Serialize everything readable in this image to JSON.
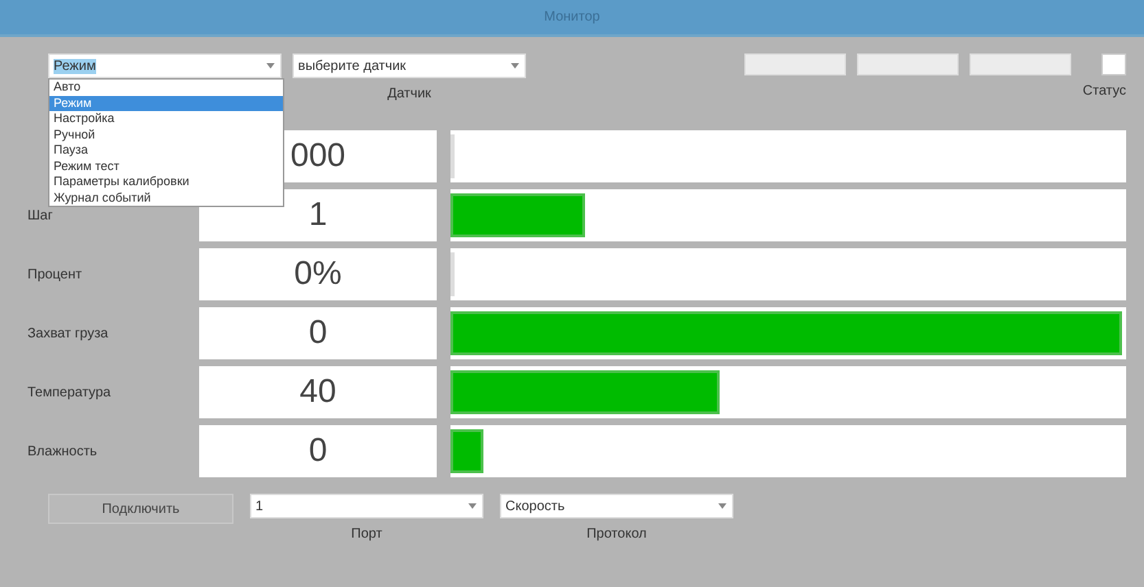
{
  "window": {
    "title": "Монитор"
  },
  "top": {
    "mode_combo": {
      "value": "Режим",
      "expanded": true,
      "options": [
        {
          "label": "Авто",
          "selected": false
        },
        {
          "label": "Режим",
          "selected": true
        },
        {
          "label": "Настройка",
          "selected": false
        },
        {
          "label": "Ручной",
          "selected": false
        },
        {
          "label": "Пауза",
          "selected": false
        },
        {
          "label": "Режим тест",
          "selected": false
        },
        {
          "label": "Параметры калибровки",
          "selected": false
        },
        {
          "label": "Журнал событий",
          "selected": false
        }
      ]
    },
    "device_combo": {
      "value": "выберите датчик",
      "label": "Датчик"
    },
    "status_checked": false,
    "status_label": "Статус"
  },
  "rows": [
    {
      "value": "000",
      "level": 0
    },
    {
      "label": "Шаг",
      "value": "1",
      "level": 0.2
    },
    {
      "label": "Процент",
      "value": "0%",
      "level": 0
    },
    {
      "label": "Захват груза",
      "value": "0",
      "level": 1
    },
    {
      "label": "Температура",
      "value": "40",
      "level": 0.4
    },
    {
      "label": "Влажность",
      "value": "0",
      "level": 0.05
    }
  ],
  "bottom": {
    "connect_button": "Подключить",
    "port_combo": {
      "value": "1",
      "label": "Порт"
    },
    "protocol_combo": {
      "value": "Скорость",
      "label": "Протокол"
    }
  }
}
